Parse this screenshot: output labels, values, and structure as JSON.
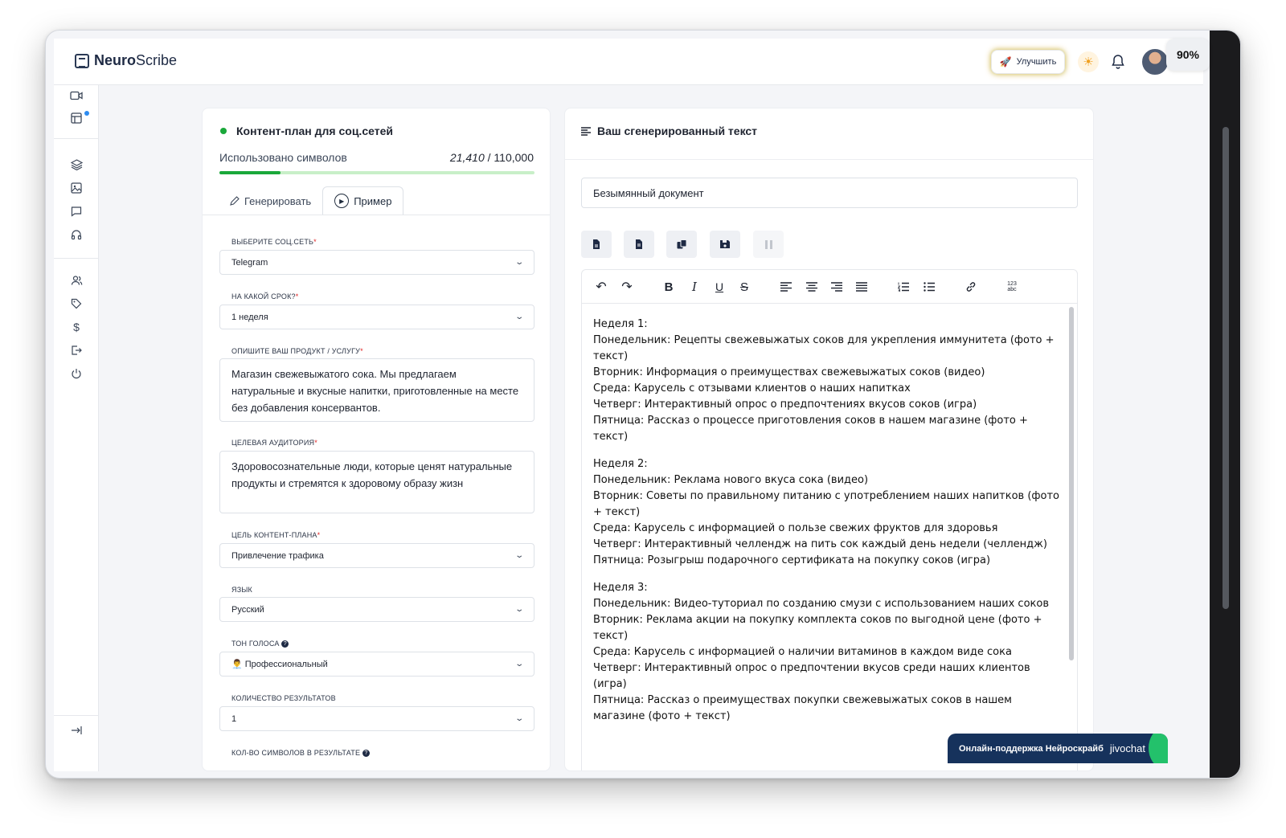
{
  "app": {
    "brand_prefix": "Neuro",
    "brand_suffix": "Scribe"
  },
  "header": {
    "upgrade_label": "Улучшить",
    "zoom": "90%"
  },
  "form": {
    "title": "Контент-план для соц.сетей",
    "usage_label": "Использовано символов",
    "usage_used": "21,410",
    "usage_total": "/ 110,000",
    "usage_fraction": 0.195,
    "tabs": {
      "generate": "Генерировать",
      "example": "Пример"
    },
    "fields": {
      "social": {
        "label": "Выберите соц.сеть",
        "value": "Telegram"
      },
      "period": {
        "label": "На какой срок?",
        "value": "1 неделя"
      },
      "product": {
        "label": "Опишите ваш продукт / услугу",
        "value": "Магазин свежевыжатого сока. Мы предлагаем натуральные и вкусные напитки, приготовленные на месте без добавления консервантов."
      },
      "audience": {
        "label": "Целевая аудитория",
        "value": "Здоровосознательные люди, которые ценят натуральные продукты и стремятся к здоровому образу жизн"
      },
      "goal": {
        "label": "Цель контент-плана",
        "value": "Привлечение трафика"
      },
      "language": {
        "label": "Язык",
        "value": "Русский"
      },
      "tone": {
        "label": "Тон голоса",
        "value": "👨‍💼 Профессиональный"
      },
      "results": {
        "label": "Количество результатов",
        "value": "1"
      },
      "chars": {
        "label": "Кол-во символов в результате"
      }
    },
    "required_mark": "*",
    "help_mark": "?"
  },
  "output": {
    "title": "Ваш сгенерированный текст",
    "doc_name": "Безымянный документ",
    "weeks": [
      {
        "heading": "Неделя 1:",
        "lines": [
          "Понедельник: Рецепты свежевыжатых соков для укрепления иммунитета (фото + текст)",
          "Вторник: Информация о преимуществах свежевыжатых соков (видео)",
          "Среда: Карусель с отзывами клиентов о наших напитках",
          "Четверг: Интерактивный опрос о предпочтениях вкусов соков (игра)",
          "Пятница: Рассказ о процессе приготовления соков в нашем магазине (фото + текст)"
        ]
      },
      {
        "heading": "Неделя 2:",
        "lines": [
          "Понедельник: Реклама нового вкуса сока (видео)",
          "Вторник: Советы по правильному питанию с употреблением наших напитков (фото + текст)",
          "Среда: Карусель с информацией о пользе свежих фруктов для здоровья",
          "Четверг: Интерактивный челлендж на пить сок каждый день недели (челлендж)",
          "Пятница: Розыгрыш подарочного сертификата на покупку соков (игра)"
        ]
      },
      {
        "heading": "Неделя 3:",
        "lines": [
          "Понедельник: Видео-туториал по созданию смузи с использованием наших соков",
          "Вторник: Реклама акции на покупку комплекта соков по выгодной цене (фото + текст)",
          "Среда: Карусель с информацией о наличии витаминов в каждом виде сока",
          "Четверг: Интерактивный опрос о предпочтении вкусов среди наших клиентов (игра)",
          "Пятница: Рассказ о преимуществах покупки свежевыжатых соков в нашем магазине (фото + текст)"
        ]
      }
    ],
    "spellcheck_glyph": "123\nabc"
  },
  "support": {
    "label": "Онлайн-поддержка Нейроскрайб",
    "brand": "jivochat"
  },
  "colors": {
    "accent_green": "#1aa83a",
    "navy": "#16325c",
    "required_red": "#e02424"
  }
}
